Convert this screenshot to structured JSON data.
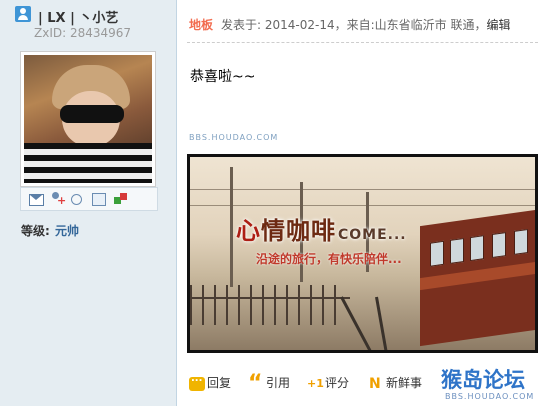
{
  "user": {
    "name": "| LX | 丶小艺",
    "zxid": "ZxID:  28434967",
    "level_label": "等级:",
    "level_value": "元帅"
  },
  "user_actions": [
    "mail-icon",
    "add-friend-icon",
    "search-icon",
    "profile-icon",
    "game-icon"
  ],
  "post": {
    "floor": "地板",
    "info": "发表于: 2014-02-14，来自:山东省临沂市 联通，",
    "edit": "编辑",
    "message": "恭喜啦~~",
    "watermark": "BBS.HOUDAO.COM"
  },
  "banner": {
    "title_part1": "心",
    "title_part2": "情咖啡",
    "title_come": "COME...",
    "subtitle": "沿途的旅行，有快乐陪伴..."
  },
  "actions": {
    "reply": "回复",
    "quote": "引用",
    "rate": "评分",
    "fresh": "新鲜事"
  },
  "logo": {
    "text": "猴岛论坛",
    "url": "BBS.HOUDAO.COM"
  },
  "colors": {
    "sidebar_bg": "#e5edf2",
    "floor": "#f26c4f",
    "level": "#336699",
    "logo": "#2f74c8"
  }
}
